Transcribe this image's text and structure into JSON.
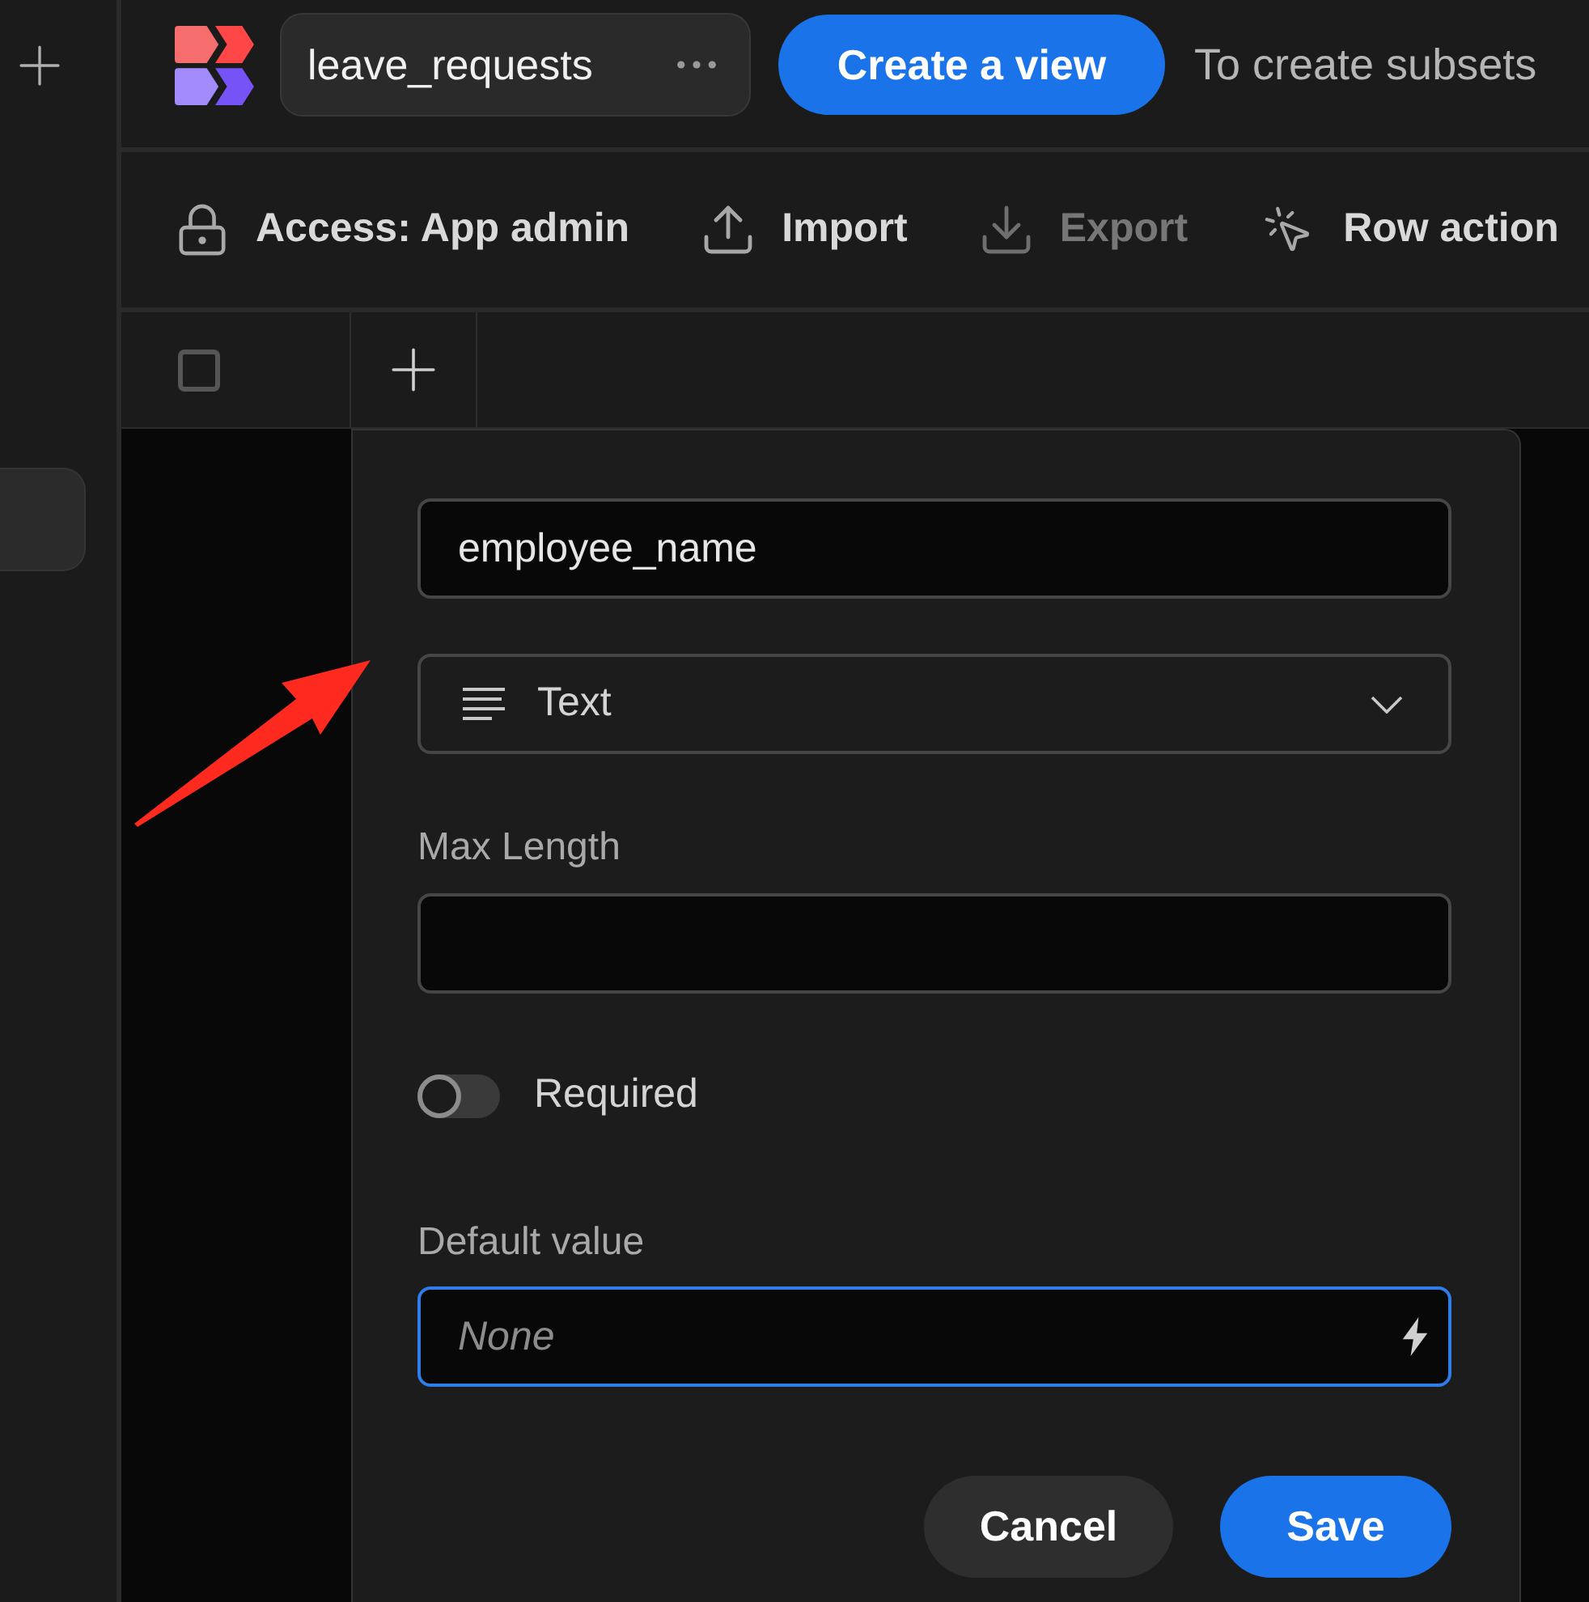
{
  "sidebar": {
    "items": [
      {
        "selected": true
      }
    ]
  },
  "header": {
    "table_name": "leave_requests",
    "create_view_button": "Create a view",
    "hint": "To create subsets"
  },
  "toolbar": [
    {
      "kind": "access",
      "label": "Access: App admin",
      "disabled": false
    },
    {
      "kind": "import",
      "label": "Import",
      "disabled": false
    },
    {
      "kind": "export",
      "label": "Export",
      "disabled": true
    },
    {
      "kind": "row_action",
      "label": "Row action",
      "disabled": false
    }
  ],
  "table_header": {
    "select_all": {
      "checked": false
    }
  },
  "field_editor": {
    "name": "employee_name",
    "type": "Text",
    "max_length": {
      "label": "Max Length"
    },
    "required": {
      "label": "Required",
      "on": false
    },
    "default_value": {
      "label": "Default value",
      "placeholder": "None",
      "focused": true
    },
    "buttons": [
      {
        "kind": "secondary",
        "label": "Cancel"
      },
      {
        "kind": "primary",
        "label": "Save"
      }
    ]
  }
}
